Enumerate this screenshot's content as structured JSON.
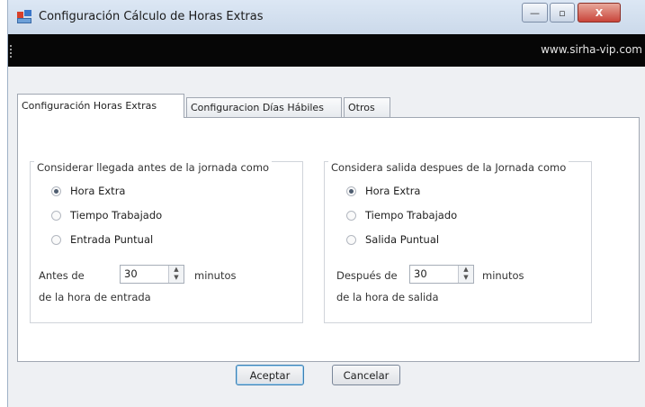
{
  "window": {
    "title": "Configuración Cálculo de Horas Extras",
    "minimize_glyph": "—",
    "maximize_glyph": "▫",
    "close_glyph": "X"
  },
  "banner": {
    "url": "www.sirha-vip.com"
  },
  "tabs": [
    {
      "label": "Configuración Horas Extras",
      "active": true
    },
    {
      "label": "Configuracion Días Hábiles",
      "active": false
    },
    {
      "label": "Otros",
      "active": false
    }
  ],
  "left_group": {
    "title": "Considerar llegada antes de la jornada como",
    "options": [
      {
        "label": "Hora Extra",
        "selected": true
      },
      {
        "label": "Tiempo Trabajado",
        "selected": false
      },
      {
        "label": "Entrada Puntual",
        "selected": false
      }
    ],
    "prefix": "Antes de",
    "value": "30",
    "unit": "minutos",
    "suffix": "de la hora de entrada"
  },
  "right_group": {
    "title": "Considera salida despues de la Jornada como",
    "options": [
      {
        "label": "Hora Extra",
        "selected": true
      },
      {
        "label": "Tiempo Trabajado",
        "selected": false
      },
      {
        "label": "Salida Puntual",
        "selected": false
      }
    ],
    "prefix": "Después de",
    "value": "30",
    "unit": "minutos",
    "suffix": "de la hora de salida"
  },
  "buttons": {
    "accept": "Aceptar",
    "cancel": "Cancelar"
  },
  "colors": {
    "banner_bg": "#060606",
    "window_bg": "#eef0f3",
    "close_red": "#c9453a"
  }
}
